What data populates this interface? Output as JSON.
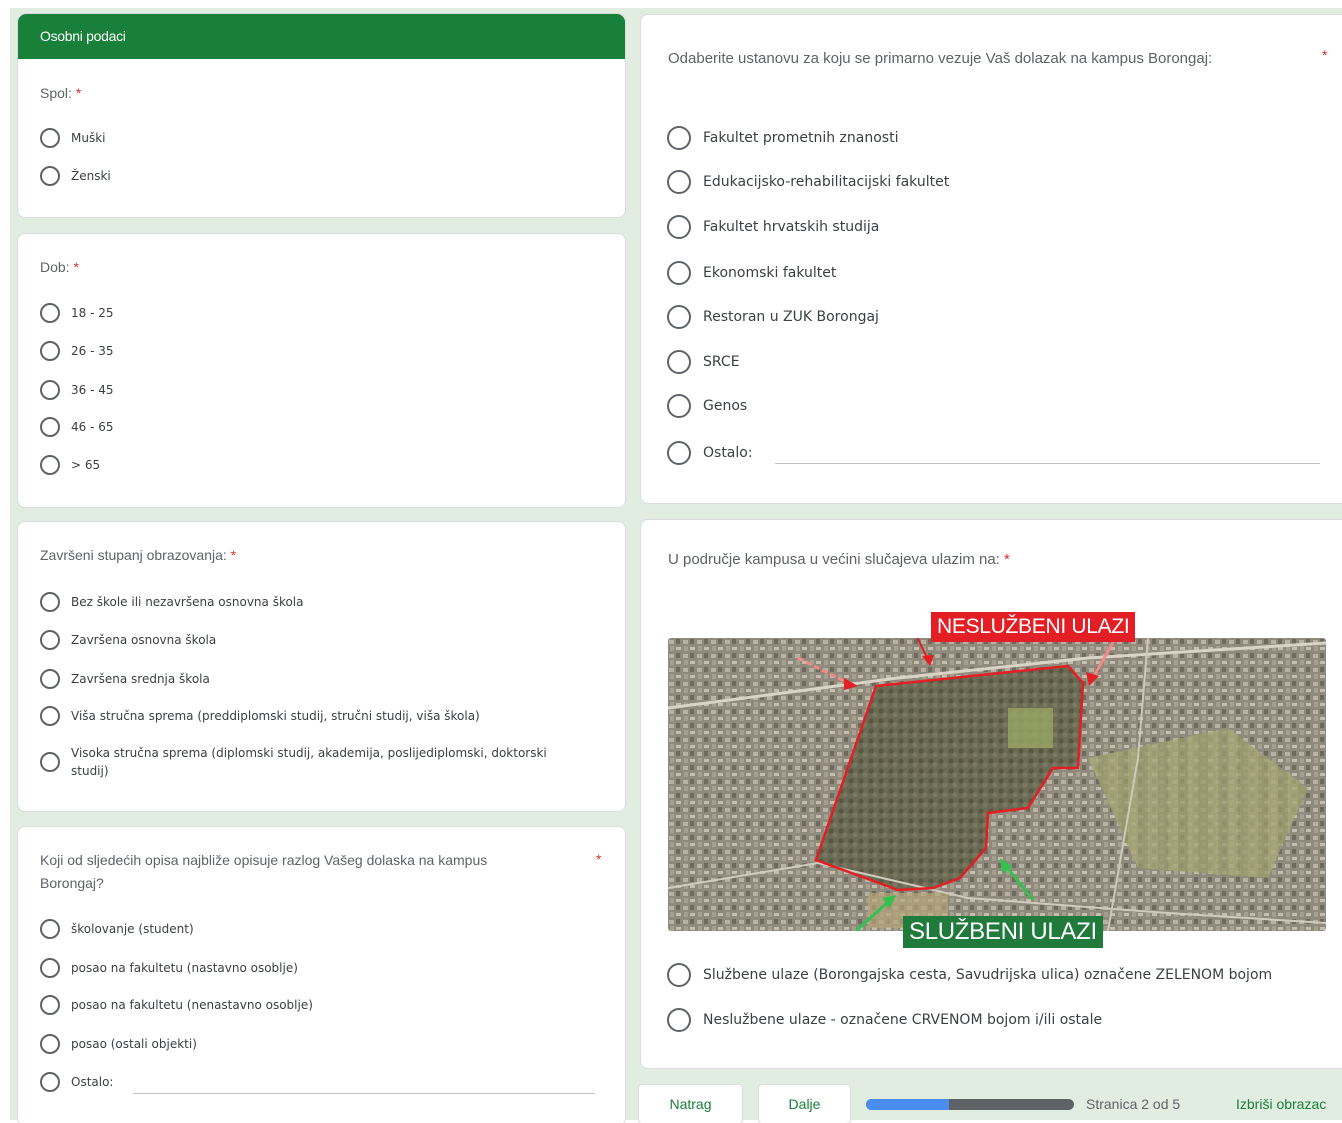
{
  "section_header": "Osobni podaci",
  "q_spol": {
    "title": "Spol:",
    "required": "*",
    "options": [
      "Muški",
      "Ženski"
    ]
  },
  "q_dob": {
    "title": "Dob:",
    "required": "*",
    "options": [
      "18 - 25",
      "26 - 35",
      "36 - 45",
      "46 - 65",
      "> 65"
    ]
  },
  "q_obrazovanje": {
    "title": "Završeni stupanj obrazovanja:",
    "required": "*",
    "options": [
      "Bez škole ili nezavršena osnovna škola",
      "Završena osnovna škola",
      "Završena srednja škola",
      "Viša stručna sprema (preddiplomski studij, stručni studij, viša škola)",
      "Visoka stručna sprema (diplomski studij, akademija, poslijediplomski, doktorski studij)"
    ]
  },
  "q_razlog": {
    "title": "Koji od sljedećih opisa najbliže opisuje razlog Vašeg dolaska na kampus Borongaj?",
    "required": "*",
    "options": [
      "školovanje (student)",
      "posao na fakultetu (nastavno osoblje)",
      "posao na fakultetu (nenastavno osoblje)",
      "posao (ostali objekti)",
      "Ostalo:"
    ]
  },
  "q_ustanova": {
    "title": "Odaberite ustanovu za koju se primarno vezuje Vaš dolazak na kampus Borongaj:",
    "required": "*",
    "options": [
      "Fakultet prometnih znanosti",
      "Edukacijsko-rehabilitacijski fakultet",
      "Fakultet hrvatskih studija",
      "Ekonomski fakultet",
      "Restoran u ZUK Borongaj",
      "SRCE",
      "Genos",
      "Ostalo:"
    ]
  },
  "q_ulaz": {
    "title": "U područje kampusa u većini slučajeva ulazim na:",
    "required": "*",
    "map_label_red": "NESLUŽBENI ULAZI",
    "map_label_green": "SLUŽBENI ULAZI",
    "options": [
      "Službene ulaze (Borongajska cesta, Savudrijska ulica) označene ZELENOM bojom",
      "Neslužbene ulaze - označene CRVENOM bojom i/ili ostale"
    ]
  },
  "nav": {
    "back": "Natrag",
    "next": "Dalje",
    "progress_fraction": 0.4,
    "page_indicator": "Stranica 2 od 5",
    "clear_form": "Izbriši obrazac"
  },
  "colors": {
    "accent_green": "#188038",
    "required_red": "#d93025",
    "background": "#e2ede2",
    "progress_fill": "#4a8df0",
    "campus_outline": "#e31e24",
    "official_arrow": "#33c24d"
  }
}
